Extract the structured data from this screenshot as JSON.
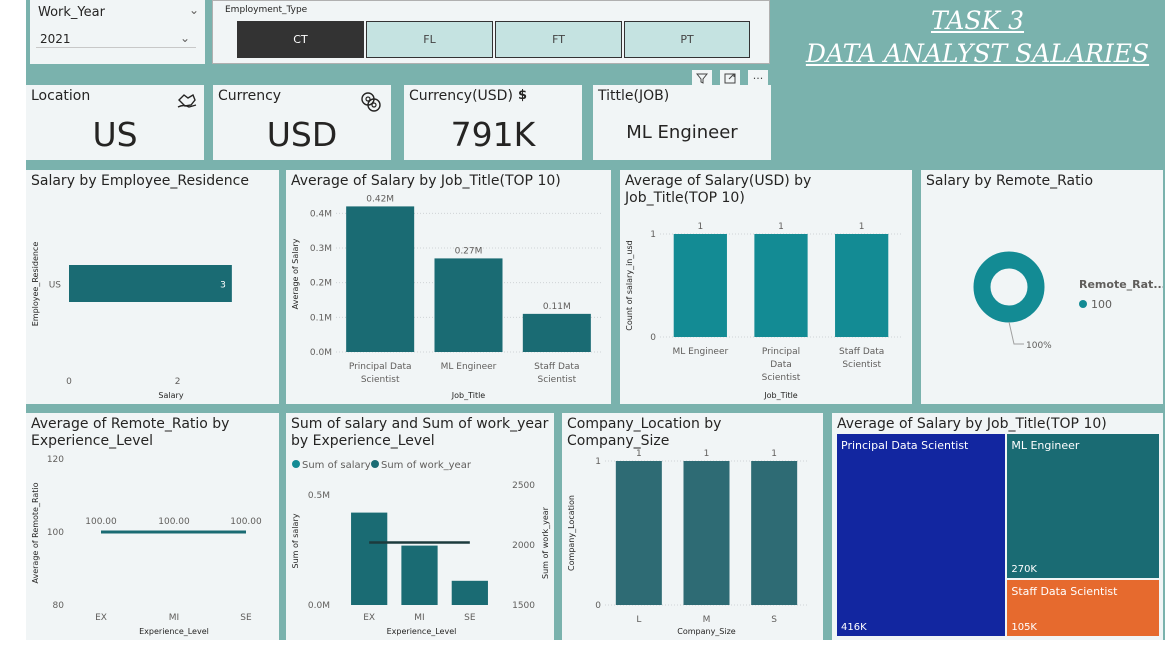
{
  "slicers": {
    "work_year": {
      "label": "Work_Year",
      "value": "2021"
    },
    "employment_type": {
      "label": "Employment_Type",
      "options": [
        "CT",
        "FL",
        "FT",
        "PT"
      ],
      "selected": "CT"
    }
  },
  "title": {
    "line1": "TASK 3",
    "line2": "DATA ANALYST SALARIES"
  },
  "kpis": {
    "location": {
      "label": "Location",
      "value": "US",
      "icon": "map-hand-icon"
    },
    "currency": {
      "label": "Currency",
      "value": "USD",
      "icon": "coins-icon"
    },
    "currency_usd": {
      "label": "Currency(USD)",
      "value": "791K",
      "icon": "dollar-icon",
      "symbol": "$"
    },
    "title_job": {
      "label": "Tittle(JOB)",
      "value": "ML Engineer"
    }
  },
  "colors": {
    "teal": "#1a6b73",
    "teal_bright": "#138b94",
    "navy": "#1226a0",
    "orange": "#e66a2e",
    "slicer_selected": "#333333",
    "slicer_unselected": "#c5e3e1"
  },
  "chart_data": [
    {
      "id": "salary_by_residence",
      "type": "bar",
      "title": "Salary by Employee_Residence",
      "orientation": "horizontal",
      "categories": [
        "US"
      ],
      "values": [
        3
      ],
      "data_labels": [
        "3"
      ],
      "xlabel": "Salary",
      "ylabel": "Employee_Residence",
      "xticks": [
        "0",
        "2"
      ],
      "xlim": [
        0,
        3.5
      ]
    },
    {
      "id": "avg_salary_by_title",
      "type": "bar",
      "title": "Average of Salary by Job_Title(TOP 10)",
      "categories": [
        "Principal Data Scientist",
        "ML Engineer",
        "Staff Data Scientist"
      ],
      "category_lines": [
        [
          "Principal Data",
          "Scientist"
        ],
        [
          "ML Engineer"
        ],
        [
          "Staff Data",
          "Scientist"
        ]
      ],
      "values": [
        0.42,
        0.27,
        0.11
      ],
      "data_labels": [
        "0.42M",
        "0.27M",
        "0.11M"
      ],
      "xlabel": "Job_Title",
      "ylabel": "Average of Salary",
      "yticks": [
        "0.0M",
        "0.1M",
        "0.2M",
        "0.3M",
        "0.4M"
      ],
      "ylim": [
        0,
        0.45
      ]
    },
    {
      "id": "avg_salary_usd_by_title",
      "type": "bar",
      "title": "Average of Salary(USD) by Job_Title(TOP 10)",
      "categories": [
        "ML Engineer",
        "Principal Data Scientist",
        "Staff Data Scientist"
      ],
      "category_lines": [
        [
          "ML Engineer"
        ],
        [
          "Principal",
          "Data",
          "Scientist"
        ],
        [
          "Staff Data",
          "Scientist"
        ]
      ],
      "values": [
        1,
        1,
        1
      ],
      "data_labels": [
        "1",
        "1",
        "1"
      ],
      "xlabel": "Job_Title",
      "ylabel": "Count of salary_in_usd",
      "yticks": [
        "0",
        "1"
      ],
      "ylim": [
        0,
        1
      ]
    },
    {
      "id": "salary_by_remote_ratio",
      "type": "pie",
      "title": "Salary by Remote_Ratio",
      "categories": [
        "100"
      ],
      "values": [
        100
      ],
      "data_labels": [
        "100%"
      ],
      "legend_title": "Remote_Rat...",
      "legend": "right"
    },
    {
      "id": "avg_remote_by_experience",
      "type": "line",
      "title": "Average of Remote_Ratio by Experience_Level",
      "title_lines": [
        "Average of Remote_Ratio by",
        "Experience_Level"
      ],
      "categories": [
        "EX",
        "MI",
        "SE"
      ],
      "values": [
        100,
        100,
        100
      ],
      "data_labels": [
        "100.00",
        "100.00",
        "100.00"
      ],
      "xlabel": "Experience_Level",
      "ylabel": "Average of Remote_Ratio",
      "yticks": [
        "80",
        "100",
        "120"
      ],
      "ylim": [
        80,
        120
      ]
    },
    {
      "id": "sum_salary_work_year",
      "type": "bar",
      "title": "Sum of salary and Sum of work_year by Experience_Level",
      "title_lines": [
        "Sum of salary and Sum of work_year",
        "by Experience_Level"
      ],
      "categories": [
        "EX",
        "MI",
        "SE"
      ],
      "series": [
        {
          "name": "Sum of salary",
          "type": "bar",
          "values": [
            0.42,
            0.27,
            0.11
          ]
        },
        {
          "name": "Sum of work_year",
          "type": "line",
          "values": [
            2021,
            2021,
            2021
          ]
        }
      ],
      "xlabel": "Experience_Level",
      "ylabel": "Sum of salary",
      "y2label": "Sum of work_year",
      "yticks": [
        "0.0M",
        "0.5M"
      ],
      "ylim": [
        0,
        0.6
      ],
      "y2ticks": [
        "1500",
        "2000",
        "2500"
      ],
      "y2lim": [
        1500,
        2600
      ],
      "legend": "top"
    },
    {
      "id": "company_location_by_size",
      "type": "bar",
      "title": "Company_Location by Company_Size",
      "categories": [
        "L",
        "M",
        "S"
      ],
      "values": [
        1,
        1,
        1
      ],
      "data_labels": [
        "1",
        "1",
        "1"
      ],
      "xlabel": "Company_Size",
      "ylabel": "Company_Location",
      "yticks": [
        "0",
        "1"
      ],
      "ylim": [
        0,
        1
      ]
    },
    {
      "id": "treemap_avg_salary",
      "type": "treemap",
      "title": "Average of Salary by Job_Title(TOP 10)",
      "categories": [
        "Principal Data Scientist",
        "ML Engineer",
        "Staff Data Scientist"
      ],
      "values": [
        416,
        270,
        105
      ],
      "data_labels": [
        "416K",
        "270K",
        "105K"
      ]
    }
  ]
}
